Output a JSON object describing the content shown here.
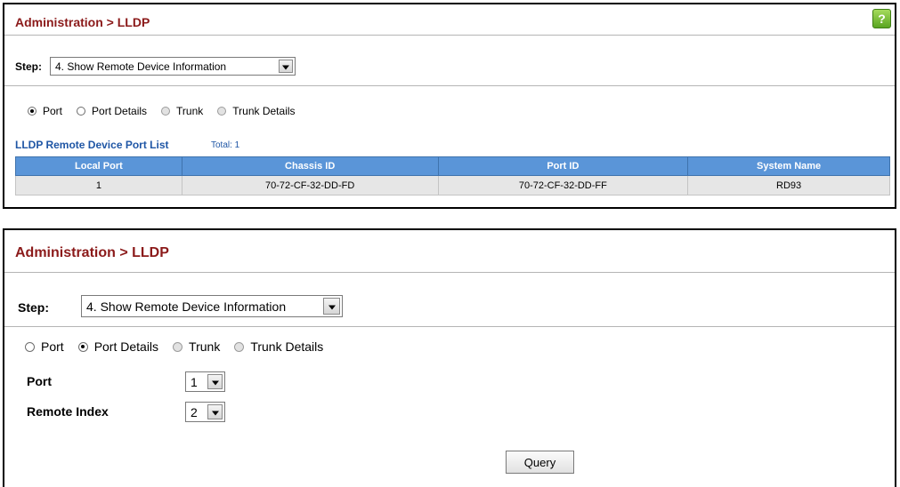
{
  "panel1": {
    "title": "Administration > LLDP",
    "step_label": "Step:",
    "step_value": "4. Show Remote Device Information",
    "radios": [
      {
        "label": "Port",
        "checked": true
      },
      {
        "label": "Port Details",
        "checked": false
      },
      {
        "label": "Trunk",
        "checked": false
      },
      {
        "label": "Trunk Details",
        "checked": false
      }
    ],
    "list_title": "LLDP Remote Device Port List",
    "total": "Total: 1",
    "table": {
      "headers": [
        "Local Port",
        "Chassis ID",
        "Port ID",
        "System Name"
      ],
      "rows": [
        [
          "1",
          "70-72-CF-32-DD-FD",
          "70-72-CF-32-DD-FF",
          "RD93"
        ]
      ]
    },
    "help_icon": "?"
  },
  "panel2": {
    "title": "Administration > LLDP",
    "step_label": "Step:",
    "step_value": "4. Show Remote Device Information",
    "radios": [
      {
        "label": "Port",
        "checked": false
      },
      {
        "label": "Port Details",
        "checked": true
      },
      {
        "label": "Trunk",
        "checked": false
      },
      {
        "label": "Trunk Details",
        "checked": false
      }
    ],
    "port_label": "Port",
    "port_value": "1",
    "remote_index_label": "Remote Index",
    "remote_index_value": "2",
    "query_label": "Query"
  },
  "icons": {
    "help": "help-icon",
    "dropdown": "chevron-down-icon"
  },
  "colors": {
    "title": "#8b1a1a",
    "accent": "#1f56a5",
    "table_header": "#5a95d8",
    "row_bg": "#e6e6e6"
  }
}
